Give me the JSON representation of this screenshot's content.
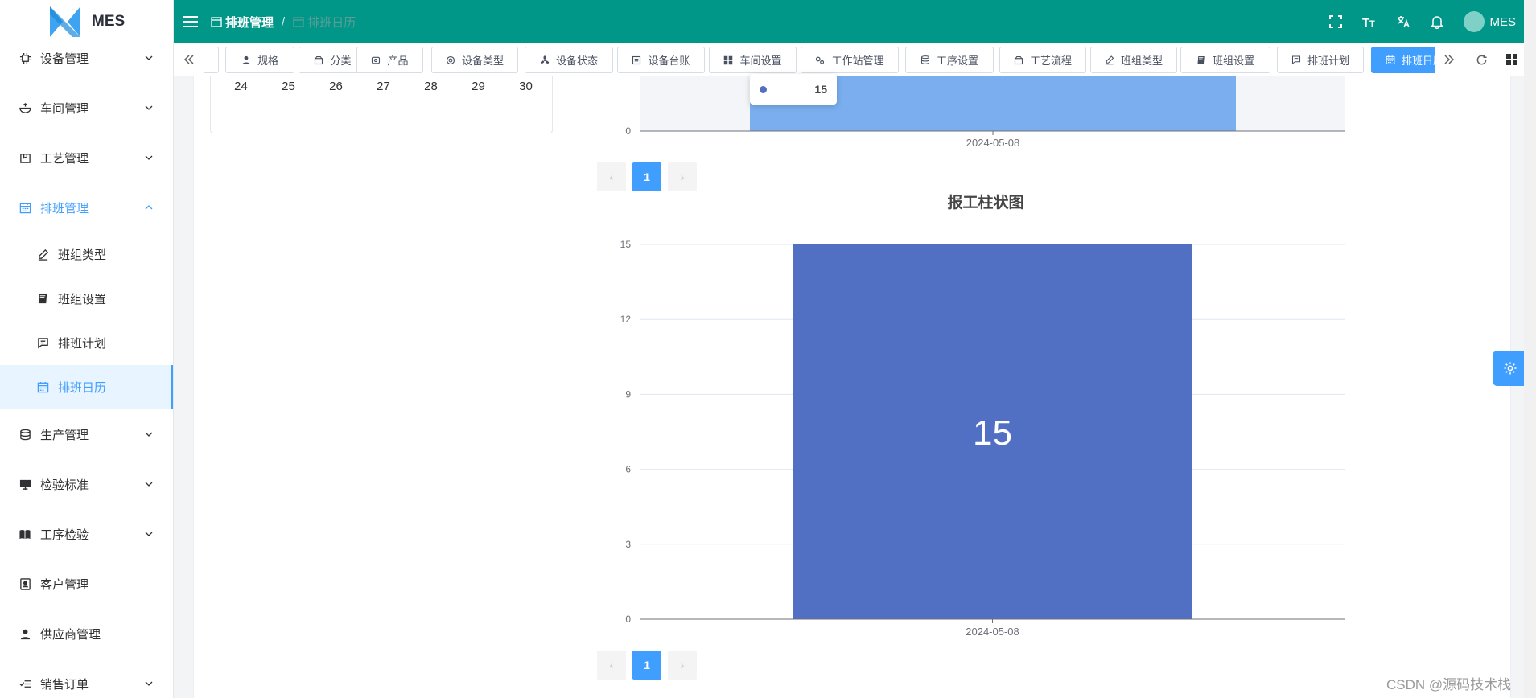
{
  "app": {
    "logo_text": "MES"
  },
  "sidebar": {
    "items": [
      {
        "label": "设备管理",
        "icon": "chip-icon",
        "expandable": true
      },
      {
        "label": "车间管理",
        "icon": "bowl-icon",
        "expandable": true
      },
      {
        "label": "工艺管理",
        "icon": "package-icon",
        "expandable": true
      },
      {
        "label": "排班管理",
        "icon": "calendar-icon",
        "expandable": true,
        "expanded": true,
        "children": [
          {
            "label": "班组类型",
            "icon": "edit-icon"
          },
          {
            "label": "班组设置",
            "icon": "book-icon"
          },
          {
            "label": "排班计划",
            "icon": "message-icon"
          },
          {
            "label": "排班日历",
            "icon": "calendar-icon",
            "active": true
          }
        ]
      },
      {
        "label": "生产管理",
        "icon": "database-icon",
        "expandable": true
      },
      {
        "label": "检验标准",
        "icon": "monitor-icon",
        "expandable": true
      },
      {
        "label": "工序检验",
        "icon": "open-book-icon",
        "expandable": true
      },
      {
        "label": "客户管理",
        "icon": "contact-card-icon",
        "expandable": false
      },
      {
        "label": "供应商管理",
        "icon": "user-icon",
        "expandable": false
      },
      {
        "label": "销售订单",
        "icon": "list-check-icon",
        "expandable": true
      }
    ]
  },
  "header": {
    "breadcrumb": [
      "排班管理",
      "排班日历"
    ],
    "user_name": "MES",
    "icons": [
      "fullscreen-icon",
      "font-size-icon",
      "translate-icon",
      "bell-icon"
    ]
  },
  "tags": [
    {
      "label": "规格",
      "icon": "user-icon"
    },
    {
      "label": "分类",
      "icon": "box-icon"
    },
    {
      "label": "产品",
      "icon": "product-icon"
    },
    {
      "label": "设备类型",
      "icon": "gear-icon"
    },
    {
      "label": "设备状态",
      "icon": "fan-icon"
    },
    {
      "label": "设备台账",
      "icon": "ledger-icon"
    },
    {
      "label": "车间设置",
      "icon": "grid-icon"
    },
    {
      "label": "工作站管理",
      "icon": "gears-icon"
    },
    {
      "label": "工序设置",
      "icon": "database-icon"
    },
    {
      "label": "工艺流程",
      "icon": "box-icon"
    },
    {
      "label": "班组类型",
      "icon": "edit-icon"
    },
    {
      "label": "班组设置",
      "icon": "book-icon"
    },
    {
      "label": "排班计划",
      "icon": "message-icon"
    },
    {
      "label": "排班日历",
      "icon": "calendar-icon",
      "active": true
    }
  ],
  "calendar": {
    "last_row": [
      "24",
      "25",
      "26",
      "27",
      "28",
      "29",
      "30"
    ]
  },
  "top_chart_fragment": {
    "tooltip_value": "15",
    "y_tick": "0",
    "x_label": "2024-05-08"
  },
  "pager_top": {
    "current": "1"
  },
  "pager_bottom": {
    "current": "1"
  },
  "chart_data": [
    {
      "type": "bar",
      "title": "",
      "categories": [
        "2024-05-08"
      ],
      "values": [
        15
      ],
      "ylim": [
        0,
        15
      ],
      "note": "upper chart, partially scrolled out of view; tooltip shows 15"
    },
    {
      "type": "bar",
      "title": "报工柱状图",
      "categories": [
        "2024-05-08"
      ],
      "values": [
        15
      ],
      "ylim": [
        0,
        15
      ],
      "yticks": [
        "0",
        "3",
        "6",
        "9",
        "12",
        "15"
      ],
      "data_label": "15",
      "color": "#516fc3",
      "grid": true
    }
  ],
  "watermark": "CSDN @源码技术栈",
  "colors": {
    "header_bg": "#009688",
    "accent": "#409eff",
    "bar": "#516fc3"
  }
}
